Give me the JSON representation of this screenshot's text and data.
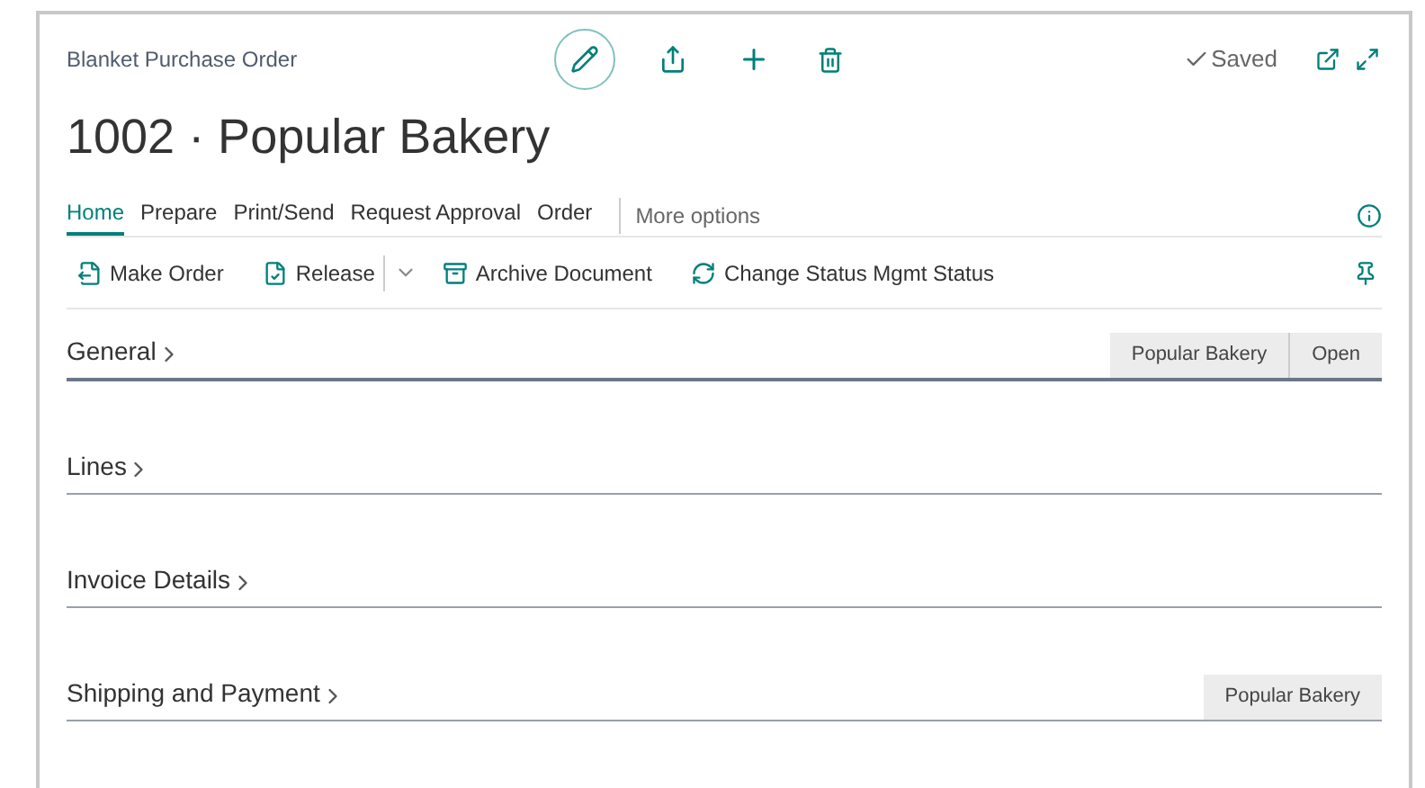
{
  "page": {
    "caption": "Blanket Purchase Order",
    "title": "1002 · Popular Bakery",
    "status": "Saved"
  },
  "tabs": [
    {
      "label": "Home",
      "selected": true
    },
    {
      "label": "Prepare",
      "selected": false
    },
    {
      "label": "Print/Send",
      "selected": false
    },
    {
      "label": "Request Approval",
      "selected": false
    },
    {
      "label": "Order",
      "selected": false
    }
  ],
  "more_options": "More options",
  "actions": [
    {
      "label": "Make Order",
      "kind": "plain"
    },
    {
      "label": "Release",
      "kind": "split"
    },
    {
      "label": "Archive Document",
      "kind": "plain"
    },
    {
      "label": "Change Status Mgmt Status",
      "kind": "plain"
    }
  ],
  "sections": [
    {
      "title": "General",
      "selected": true,
      "badges": [
        "Popular Bakery",
        "Open"
      ]
    },
    {
      "title": "Lines",
      "selected": false
    },
    {
      "title": "Invoice Details",
      "selected": false
    },
    {
      "title": "Shipping and Payment",
      "selected": false,
      "badges": [
        "Popular Bakery"
      ]
    }
  ]
}
